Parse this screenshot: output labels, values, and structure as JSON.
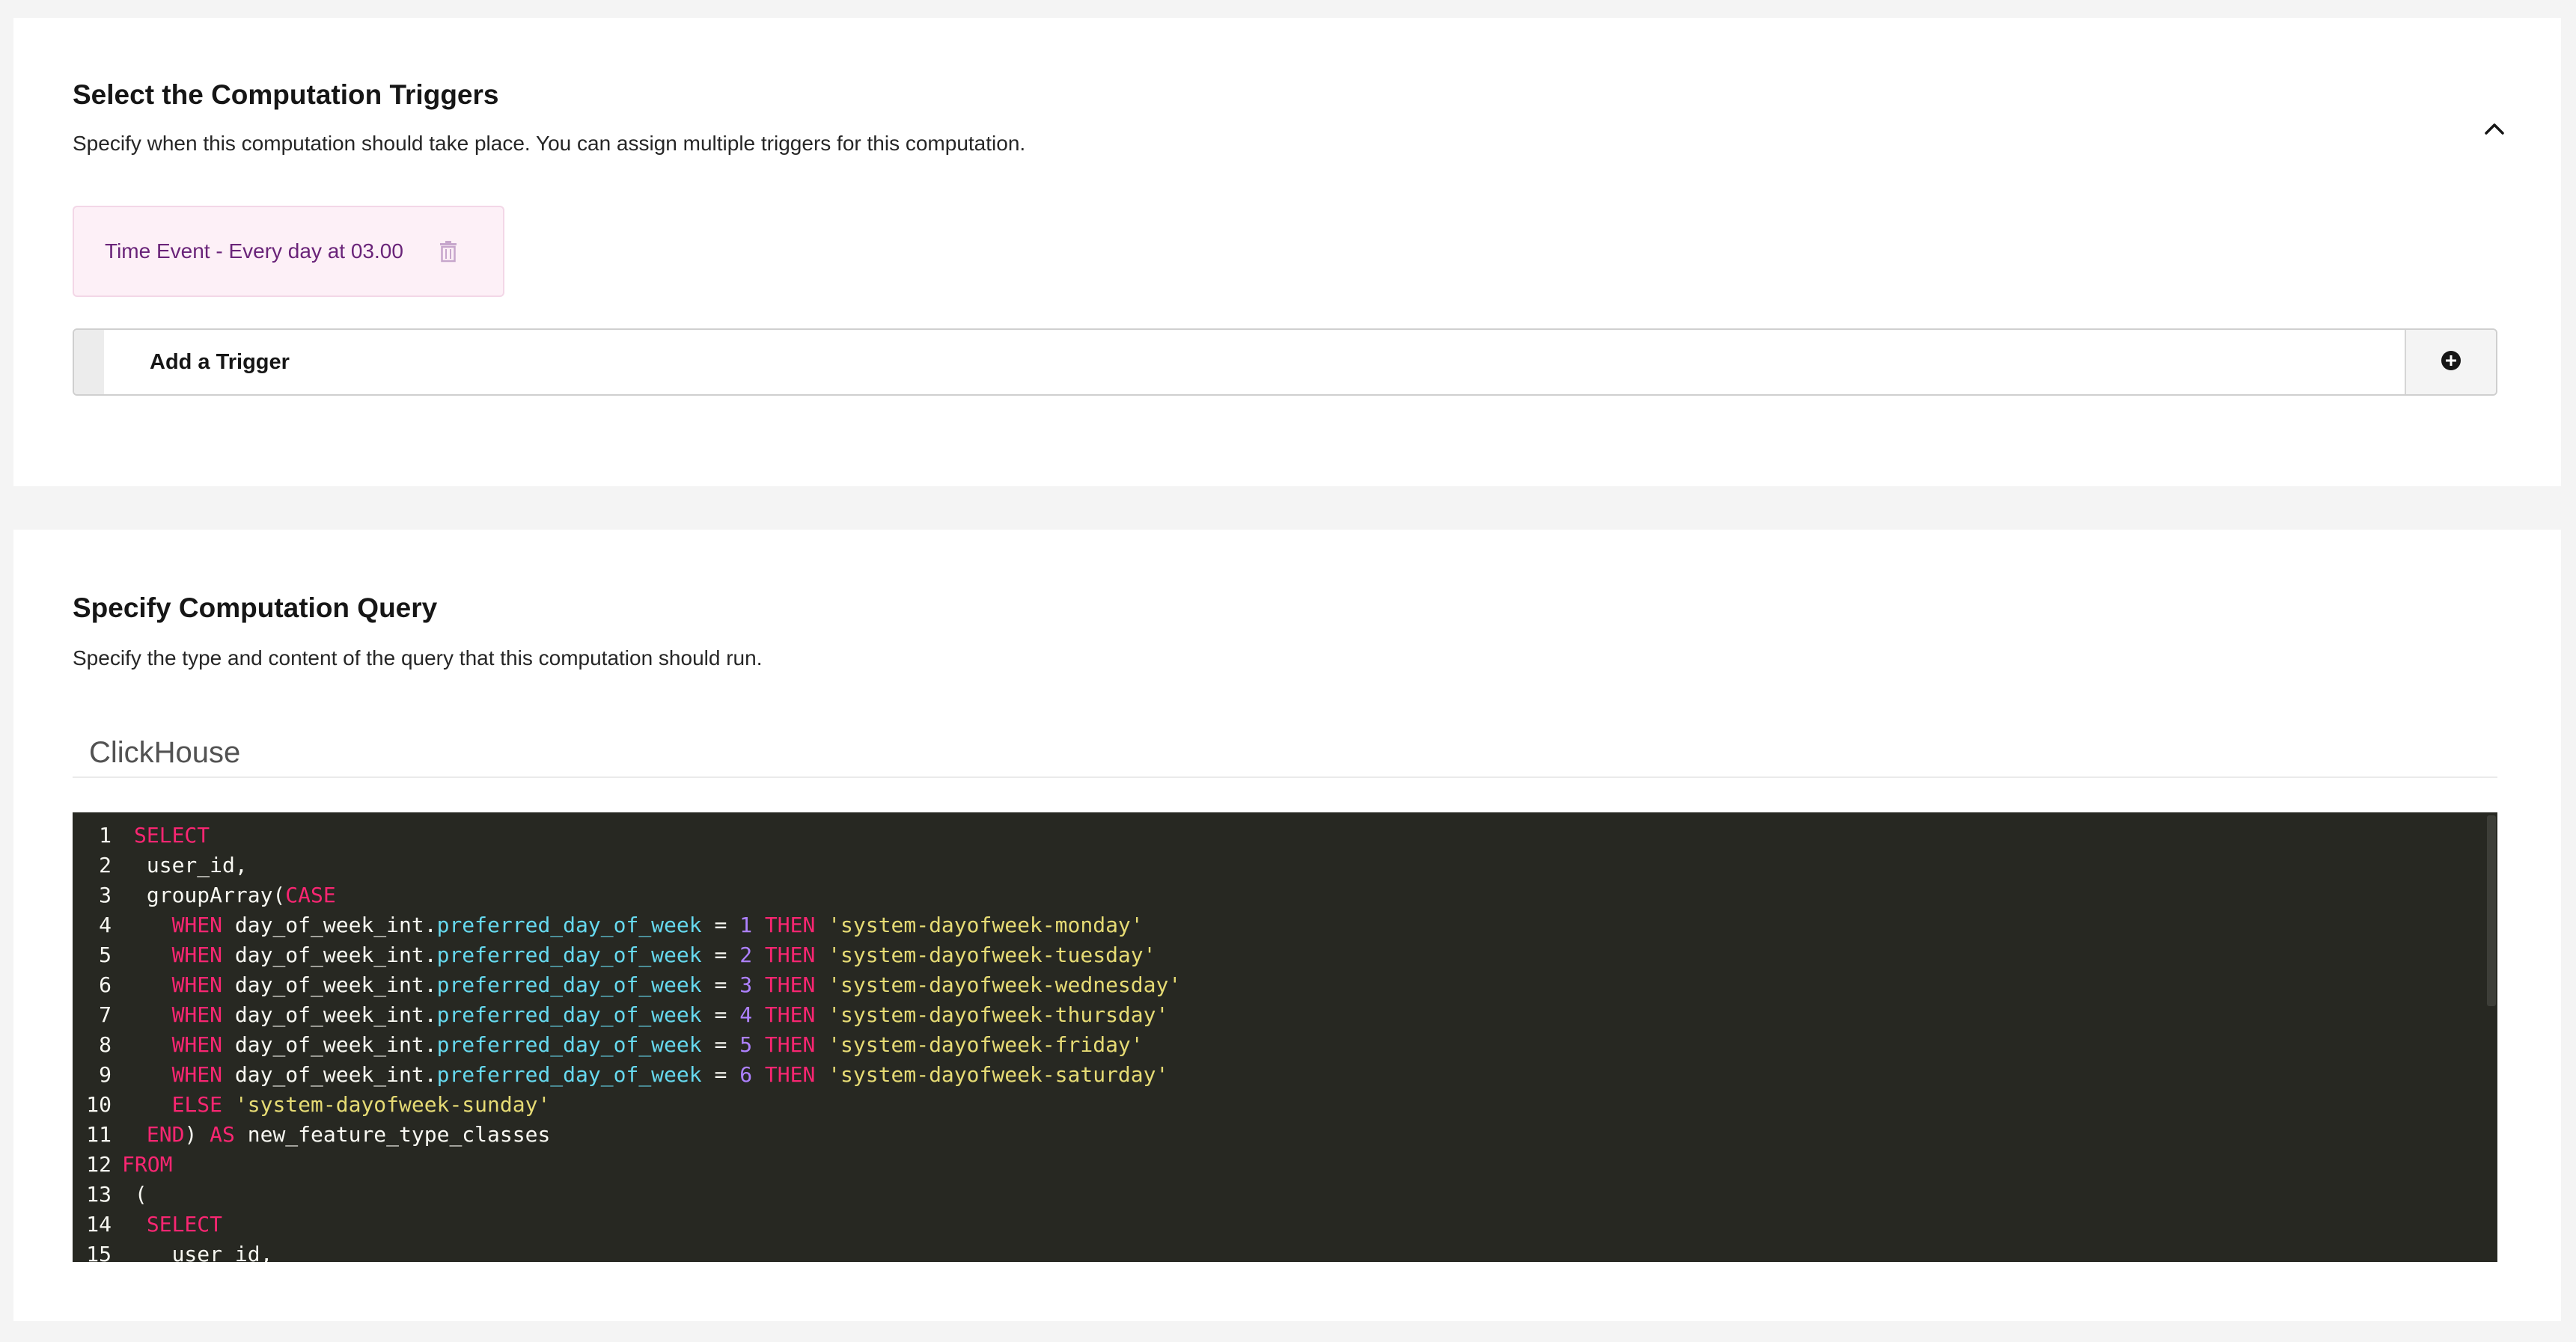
{
  "triggers_section": {
    "title": "Select the Computation Triggers",
    "description": "Specify when this computation should take place. You can assign multiple triggers for this computation.",
    "collapse_icon": "chevron-up-icon",
    "triggers": [
      {
        "label": "Time Event - Every day at 03.00",
        "delete_icon": "trash-icon"
      }
    ],
    "add_trigger": {
      "label": "Add a Trigger",
      "icon": "plus-circle-icon"
    }
  },
  "query_section": {
    "title": "Specify Computation Query",
    "description": "Specify the type and content of the query that this computation should run.",
    "query_type": "ClickHouse",
    "code": {
      "line_numbers": [
        "1",
        "2",
        "3",
        "4",
        "5",
        "6",
        "7",
        "8",
        "9",
        "10",
        "11",
        "12",
        "13",
        "14",
        "15"
      ],
      "lines": [
        [
          {
            "t": "SELECT",
            "k": "kw"
          }
        ],
        [
          {
            "t": " user_id,",
            "k": "plain"
          }
        ],
        [
          {
            "t": " groupArray(",
            "k": "plain"
          },
          {
            "t": "CASE",
            "k": "kw"
          }
        ],
        [
          {
            "t": "   ",
            "k": "plain"
          },
          {
            "t": "WHEN",
            "k": "kw"
          },
          {
            "t": " day_of_week_int.",
            "k": "plain"
          },
          {
            "t": "preferred_day_of_week",
            "k": "prop"
          },
          {
            "t": " = ",
            "k": "plain"
          },
          {
            "t": "1",
            "k": "num"
          },
          {
            "t": " ",
            "k": "plain"
          },
          {
            "t": "THEN",
            "k": "kw"
          },
          {
            "t": " ",
            "k": "plain"
          },
          {
            "t": "'system-dayofweek-monday'",
            "k": "str"
          }
        ],
        [
          {
            "t": "   ",
            "k": "plain"
          },
          {
            "t": "WHEN",
            "k": "kw"
          },
          {
            "t": " day_of_week_int.",
            "k": "plain"
          },
          {
            "t": "preferred_day_of_week",
            "k": "prop"
          },
          {
            "t": " = ",
            "k": "plain"
          },
          {
            "t": "2",
            "k": "num"
          },
          {
            "t": " ",
            "k": "plain"
          },
          {
            "t": "THEN",
            "k": "kw"
          },
          {
            "t": " ",
            "k": "plain"
          },
          {
            "t": "'system-dayofweek-tuesday'",
            "k": "str"
          }
        ],
        [
          {
            "t": "   ",
            "k": "plain"
          },
          {
            "t": "WHEN",
            "k": "kw"
          },
          {
            "t": " day_of_week_int.",
            "k": "plain"
          },
          {
            "t": "preferred_day_of_week",
            "k": "prop"
          },
          {
            "t": " = ",
            "k": "plain"
          },
          {
            "t": "3",
            "k": "num"
          },
          {
            "t": " ",
            "k": "plain"
          },
          {
            "t": "THEN",
            "k": "kw"
          },
          {
            "t": " ",
            "k": "plain"
          },
          {
            "t": "'system-dayofweek-wednesday'",
            "k": "str"
          }
        ],
        [
          {
            "t": "   ",
            "k": "plain"
          },
          {
            "t": "WHEN",
            "k": "kw"
          },
          {
            "t": " day_of_week_int.",
            "k": "plain"
          },
          {
            "t": "preferred_day_of_week",
            "k": "prop"
          },
          {
            "t": " = ",
            "k": "plain"
          },
          {
            "t": "4",
            "k": "num"
          },
          {
            "t": " ",
            "k": "plain"
          },
          {
            "t": "THEN",
            "k": "kw"
          },
          {
            "t": " ",
            "k": "plain"
          },
          {
            "t": "'system-dayofweek-thursday'",
            "k": "str"
          }
        ],
        [
          {
            "t": "   ",
            "k": "plain"
          },
          {
            "t": "WHEN",
            "k": "kw"
          },
          {
            "t": " day_of_week_int.",
            "k": "plain"
          },
          {
            "t": "preferred_day_of_week",
            "k": "prop"
          },
          {
            "t": " = ",
            "k": "plain"
          },
          {
            "t": "5",
            "k": "num"
          },
          {
            "t": " ",
            "k": "plain"
          },
          {
            "t": "THEN",
            "k": "kw"
          },
          {
            "t": " ",
            "k": "plain"
          },
          {
            "t": "'system-dayofweek-friday'",
            "k": "str"
          }
        ],
        [
          {
            "t": "   ",
            "k": "plain"
          },
          {
            "t": "WHEN",
            "k": "kw"
          },
          {
            "t": " day_of_week_int.",
            "k": "plain"
          },
          {
            "t": "preferred_day_of_week",
            "k": "prop"
          },
          {
            "t": " = ",
            "k": "plain"
          },
          {
            "t": "6",
            "k": "num"
          },
          {
            "t": " ",
            "k": "plain"
          },
          {
            "t": "THEN",
            "k": "kw"
          },
          {
            "t": " ",
            "k": "plain"
          },
          {
            "t": "'system-dayofweek-saturday'",
            "k": "str"
          }
        ],
        [
          {
            "t": "   ",
            "k": "plain"
          },
          {
            "t": "ELSE",
            "k": "kw"
          },
          {
            "t": " ",
            "k": "plain"
          },
          {
            "t": "'system-dayofweek-sunday'",
            "k": "str"
          }
        ],
        [
          {
            "t": " ",
            "k": "plain"
          },
          {
            "t": "END",
            "k": "kw"
          },
          {
            "t": ") ",
            "k": "plain"
          },
          {
            "t": "AS",
            "k": "kw"
          },
          {
            "t": " new_feature_type_classes",
            "k": "plain"
          }
        ],
        [
          {
            "t": "FROM",
            "k": "kw"
          }
        ],
        [
          {
            "t": " (",
            "k": "plain"
          }
        ],
        [
          {
            "t": " ",
            "k": "plain"
          },
          {
            "t": "SELECT",
            "k": "kw"
          }
        ],
        [
          {
            "t": "   user_id,",
            "k": "plain"
          }
        ]
      ],
      "shifted_lines": [
        11,
        12
      ]
    }
  },
  "colors": {
    "page_bg": "#f4f4f4",
    "panel_bg": "#ffffff",
    "chip_bg": "#fdf0f7",
    "chip_text": "#6a2479",
    "editor_bg": "#272822",
    "keyword": "#f92672",
    "string": "#e6db74",
    "number": "#ae81ff",
    "property": "#66d9ef"
  }
}
